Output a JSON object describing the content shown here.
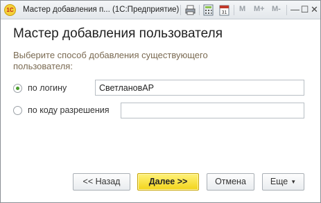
{
  "window": {
    "title": "Мастер добавления п... (1С:Предприятие)",
    "logo_text": "1С",
    "toolbar": {
      "mem_labels": [
        "M",
        "M+",
        "M-"
      ]
    },
    "controls": {
      "minimize": "—",
      "maximize": "☐",
      "close": "✕"
    }
  },
  "dialog": {
    "title": "Мастер добавления пользователя",
    "prompt": "Выберите способ добавления существующего пользователя:",
    "options": [
      {
        "label": "по логину",
        "selected": true,
        "value": "СветлановАР"
      },
      {
        "label": "по коду разрешения",
        "selected": false,
        "value": ""
      }
    ]
  },
  "buttons": {
    "back": "<< Назад",
    "next": "Далее >>",
    "cancel": "Отмена",
    "more": "Еще"
  },
  "colors": {
    "accent_button": "#f2d41a",
    "prompt_text": "#7a6a52",
    "radio_dot": "#4a9d2c"
  }
}
